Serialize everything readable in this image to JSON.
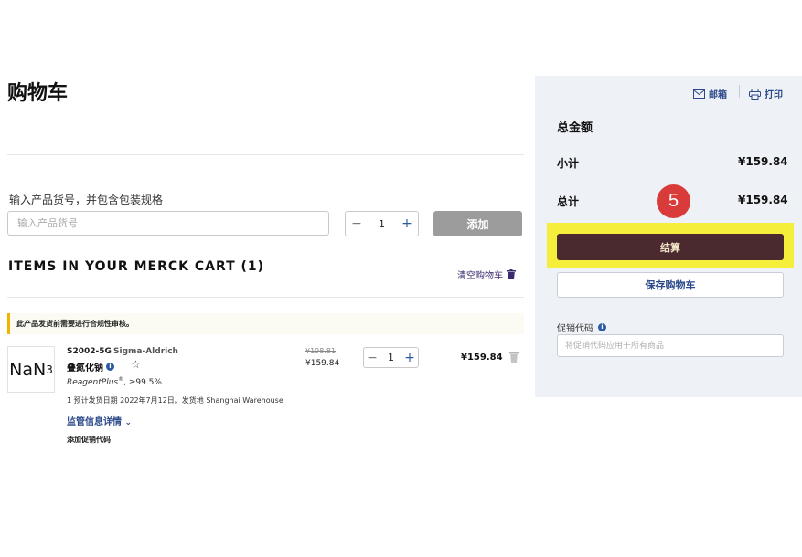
{
  "page": {
    "title": "购物车"
  },
  "sku_entry": {
    "label": "输入产品货号，并包含包装规格",
    "placeholder": "输入产品货号",
    "quantity": "1",
    "add_label": "添加"
  },
  "cart": {
    "heading": "ITEMS IN YOUR MERCK CART (1)",
    "clear_label": "清空购物车",
    "notice": "此产品发货前需要进行合规性审核。",
    "items": [
      {
        "thumb_main": "NaN",
        "thumb_sub": "3",
        "sku": "S2002-5G",
        "brand": "Sigma-Aldrich",
        "name": "叠氮化钠",
        "grade_brand": "ReagentPlus",
        "grade_mark": "®",
        "grade_purity": ", ≥99.5%",
        "ship_info": "1 预计发货日期 2022年7月12日。发货地 Shanghai Warehouse",
        "regulatory_link": "监管信息详情",
        "promo_link": "添加促销代码",
        "price_old": "¥198.81",
        "price_now": "¥159.84",
        "quantity": "1",
        "line_total": "¥159.84"
      }
    ]
  },
  "summary": {
    "email_label": "邮箱",
    "print_label": "打印",
    "title": "总金额",
    "subtotal_label": "小计",
    "subtotal_value": "¥159.84",
    "total_label": "总计",
    "total_value": "¥159.84",
    "step_number": "5",
    "checkout_label": "结算",
    "save_cart_label": "保存购物车",
    "promo_label": "促销代码",
    "promo_placeholder": "将促销代码应用于所有商品"
  },
  "colors": {
    "checkout_bg": "#4b2a2f",
    "highlight": "#f5ef3c",
    "step_badge": "#d93b3b",
    "link": "#2c4a8a",
    "sidebar_bg": "#eef1f5"
  }
}
